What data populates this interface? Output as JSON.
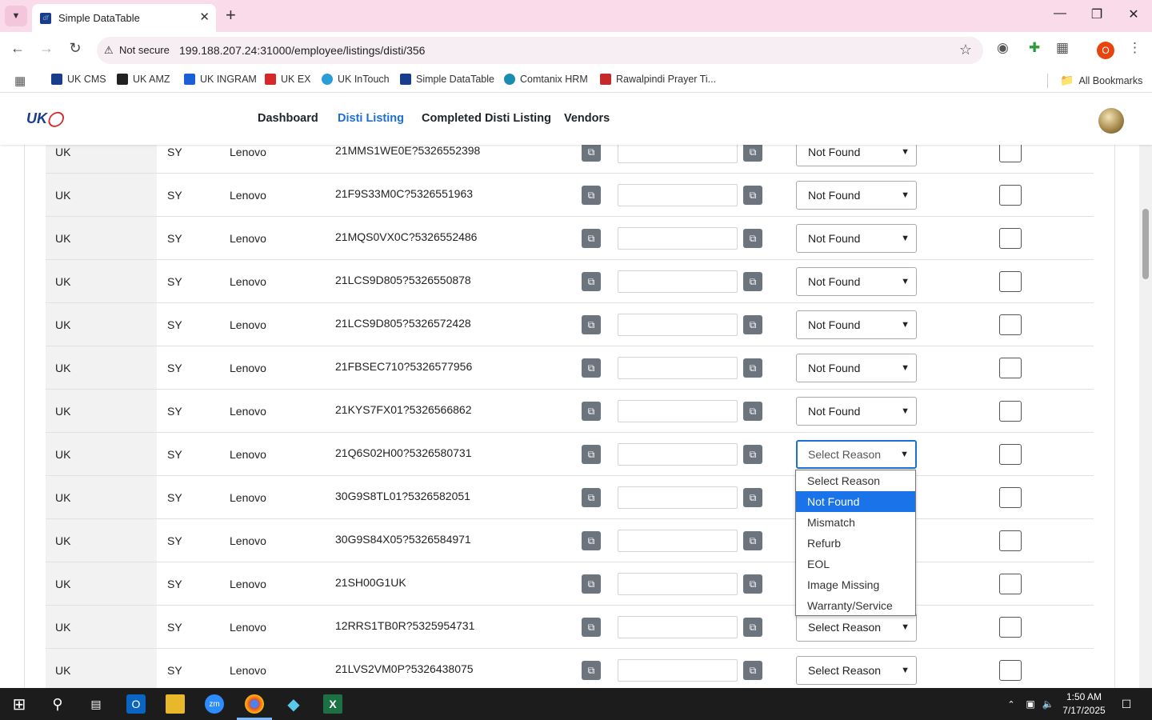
{
  "browser": {
    "tab_title": "Simple DataTable",
    "not_secure": "Not secure",
    "url": "199.188.207.24:31000/employee/listings/disti/356",
    "profile_initial": "O",
    "bookmarks": [
      "UK CMS",
      "UK AMZ",
      "UK INGRAM",
      "UK EX",
      "UK InTouch",
      "Simple DataTable",
      "Comtanix HRM",
      "Rawalpindi Prayer Ti..."
    ],
    "all_bookmarks": "All Bookmarks"
  },
  "nav": {
    "logo": "UK",
    "links": [
      "Dashboard",
      "Disti Listing",
      "Completed Disti Listing",
      "Vendors"
    ]
  },
  "table": {
    "rows": [
      {
        "c1": "UK",
        "c2": "SY",
        "c3": "Lenovo",
        "sku": "21MMS1WE0E?5326552398",
        "reason": "Not Found"
      },
      {
        "c1": "UK",
        "c2": "SY",
        "c3": "Lenovo",
        "sku": "21F9S33M0C?5326551963",
        "reason": "Not Found"
      },
      {
        "c1": "UK",
        "c2": "SY",
        "c3": "Lenovo",
        "sku": "21MQS0VX0C?5326552486",
        "reason": "Not Found"
      },
      {
        "c1": "UK",
        "c2": "SY",
        "c3": "Lenovo",
        "sku": "21LCS9D805?5326550878",
        "reason": "Not Found"
      },
      {
        "c1": "UK",
        "c2": "SY",
        "c3": "Lenovo",
        "sku": "21LCS9D805?5326572428",
        "reason": "Not Found"
      },
      {
        "c1": "UK",
        "c2": "SY",
        "c3": "Lenovo",
        "sku": "21FBSEC710?5326577956",
        "reason": "Not Found"
      },
      {
        "c1": "UK",
        "c2": "SY",
        "c3": "Lenovo",
        "sku": "21KYS7FX01?5326566862",
        "reason": "Not Found"
      },
      {
        "c1": "UK",
        "c2": "SY",
        "c3": "Lenovo",
        "sku": "21Q6S02H00?5326580731",
        "reason": "Select Reason"
      },
      {
        "c1": "UK",
        "c2": "SY",
        "c3": "Lenovo",
        "sku": "30G9S8TL01?5326582051",
        "reason": ""
      },
      {
        "c1": "UK",
        "c2": "SY",
        "c3": "Lenovo",
        "sku": "30G9S84X05?5326584971",
        "reason": ""
      },
      {
        "c1": "UK",
        "c2": "SY",
        "c3": "Lenovo",
        "sku": "21SH00G1UK",
        "reason": ""
      },
      {
        "c1": "UK",
        "c2": "SY",
        "c3": "Lenovo",
        "sku": "12RRS1TB0R?5325954731",
        "reason": "Select Reason"
      },
      {
        "c1": "UK",
        "c2": "SY",
        "c3": "Lenovo",
        "sku": "21LVS2VM0P?5326438075",
        "reason": "Select Reason"
      }
    ]
  },
  "dropdown": {
    "options": [
      "Select Reason",
      "Not Found",
      "Mismatch",
      "Refurb",
      "EOL",
      "Image Missing",
      "Warranty/Service"
    ],
    "highlighted": "Not Found"
  },
  "taskbar": {
    "time": "1:50 AM",
    "date": "7/17/2025"
  }
}
